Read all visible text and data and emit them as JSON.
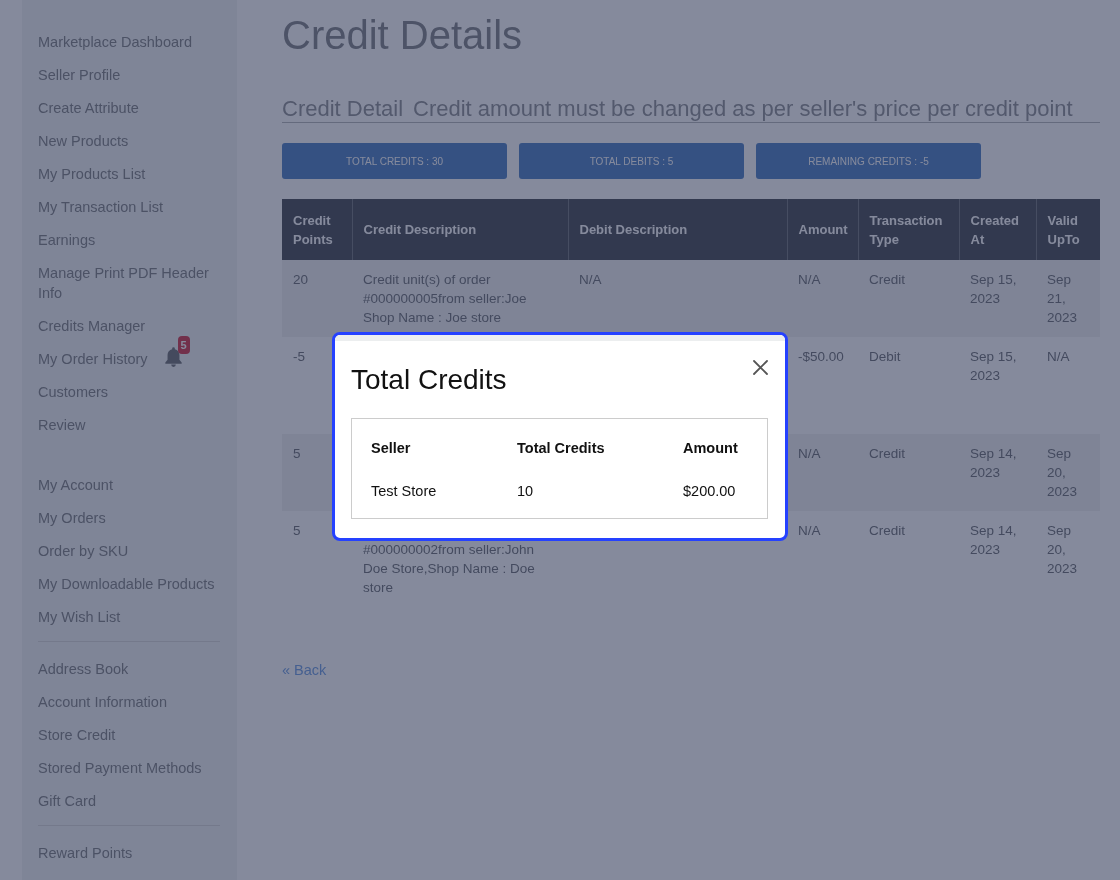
{
  "sidebar": {
    "groups": [
      {
        "divider": false,
        "items": [
          {
            "label": "Marketplace Dashboard"
          },
          {
            "label": "Seller Profile"
          },
          {
            "label": "Create Attribute"
          },
          {
            "label": "New Products"
          },
          {
            "label": "My Products List"
          },
          {
            "label": "My Transaction List"
          },
          {
            "label": "Earnings"
          },
          {
            "label": "Manage Print PDF Header Info"
          },
          {
            "label": "Credits Manager"
          },
          {
            "label": "My Order History",
            "notification_count": "5"
          },
          {
            "label": "Customers"
          },
          {
            "label": "Review"
          }
        ]
      },
      {
        "divider": false,
        "items": [
          {
            "label": "My Account"
          },
          {
            "label": "My Orders"
          },
          {
            "label": "Order by SKU"
          },
          {
            "label": "My Downloadable Products"
          },
          {
            "label": "My Wish List"
          }
        ]
      },
      {
        "divider": true,
        "items": [
          {
            "label": "Address Book"
          },
          {
            "label": "Account Information"
          },
          {
            "label": "Store Credit"
          },
          {
            "label": "Stored Payment Methods"
          },
          {
            "label": "Gift Card"
          }
        ]
      },
      {
        "divider": true,
        "items": [
          {
            "label": "Reward Points"
          }
        ]
      }
    ]
  },
  "page": {
    "title": "Credit Details",
    "section_title": "Credit Detail",
    "notice": "Credit amount must be changed as per seller's price per credit point"
  },
  "summary_buttons": [
    "TOTAL CREDITS : 30",
    "TOTAL DEBITS : 5",
    "REMAINING CREDITS : -5"
  ],
  "table": {
    "columns": [
      "Credit Points",
      "Credit Description",
      "Debit Description",
      "Amount",
      "Transaction Type",
      "Created At",
      "Valid UpTo"
    ],
    "rows": [
      {
        "credit_points": "20",
        "credit_description": "Credit unit(s) of order #000000005from seller:Joe Shop Name : Joe store",
        "debit_description": "N/A",
        "amount": "N/A",
        "transaction_type": "Credit",
        "created_at": "Sep 15, 2023",
        "valid_upto": "Sep 21, 2023"
      },
      {
        "credit_points": "-5",
        "amount": "-$50.00",
        "transaction_type": "Debit",
        "created_at": "Sep 15, 2023",
        "valid_upto": "N/A"
      },
      {
        "credit_points": "5",
        "amount": "N/A",
        "transaction_type": "Credit",
        "created_at": "Sep 14, 2023",
        "valid_upto": "Sep 20, 2023"
      },
      {
        "credit_points": "5",
        "credit_description_continued": "#000000002from seller:John Doe Store,Shop Name : Doe store",
        "amount": "N/A",
        "transaction_type": "Credit",
        "created_at": "Sep 14, 2023",
        "valid_upto": "Sep 20, 2023"
      }
    ]
  },
  "back_link": "« Back",
  "modal": {
    "title": "Total Credits",
    "table": {
      "columns": [
        "Seller",
        "Total Credits",
        "Amount"
      ],
      "rows": [
        [
          "Test Store",
          "10",
          "$200.00"
        ]
      ]
    }
  }
}
